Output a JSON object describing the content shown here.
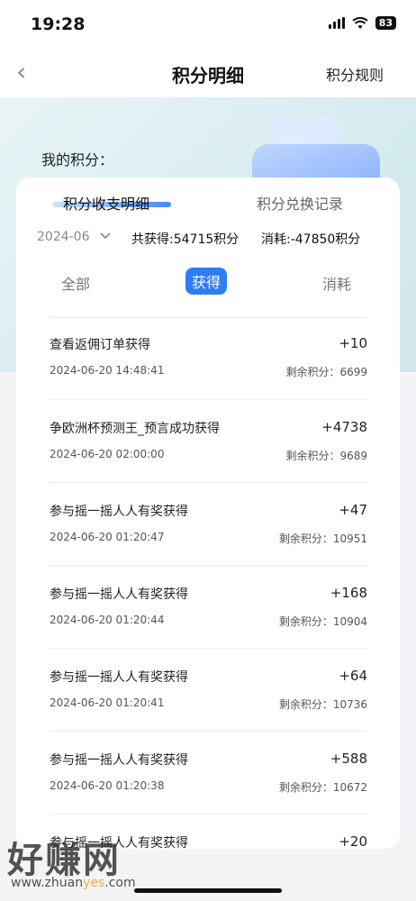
{
  "status": {
    "time": "19:28",
    "battery": "83"
  },
  "nav": {
    "back_glyph": "‹",
    "title": "积分明细",
    "rule_link": "积分规则"
  },
  "hero": {
    "my_points_label": "我的积分："
  },
  "tabs": {
    "active": "积分收支明细",
    "inactive": "积分兑换记录"
  },
  "filter": {
    "month": "2024-06",
    "earned": "共获得:54715积分",
    "spent": "消耗:-47850积分"
  },
  "segments": {
    "all": "全部",
    "earned": "获得",
    "spent": "消耗"
  },
  "records": [
    {
      "title": "查看返佣订单获得",
      "amount": "+10",
      "time": "2024-06-20 14:48:41",
      "balance": "剩余积分：6699"
    },
    {
      "title": "争欧洲杯预测王_预言成功获得",
      "amount": "+4738",
      "time": "2024-06-20 02:00:00",
      "balance": "剩余积分：9689"
    },
    {
      "title": "参与摇一摇人人有奖获得",
      "amount": "+47",
      "time": "2024-06-20 01:20:47",
      "balance": "剩余积分：10951"
    },
    {
      "title": "参与摇一摇人人有奖获得",
      "amount": "+168",
      "time": "2024-06-20 01:20:44",
      "balance": "剩余积分：10904"
    },
    {
      "title": "参与摇一摇人人有奖获得",
      "amount": "+64",
      "time": "2024-06-20 01:20:41",
      "balance": "剩余积分：10736"
    },
    {
      "title": "参与摇一摇人人有奖获得",
      "amount": "+588",
      "time": "2024-06-20 01:20:38",
      "balance": "剩余积分：10672"
    },
    {
      "title": "参与摇一摇人人有奖获得",
      "amount": "+20",
      "time": "",
      "balance": ""
    }
  ],
  "watermark": {
    "brand": "好赚网",
    "url_start": "www.zhuan",
    "url_mid": "yes",
    "url_end": ".com"
  },
  "colors": {
    "accent": "#2f7cf6",
    "hero_bg": "#d6ecef"
  }
}
